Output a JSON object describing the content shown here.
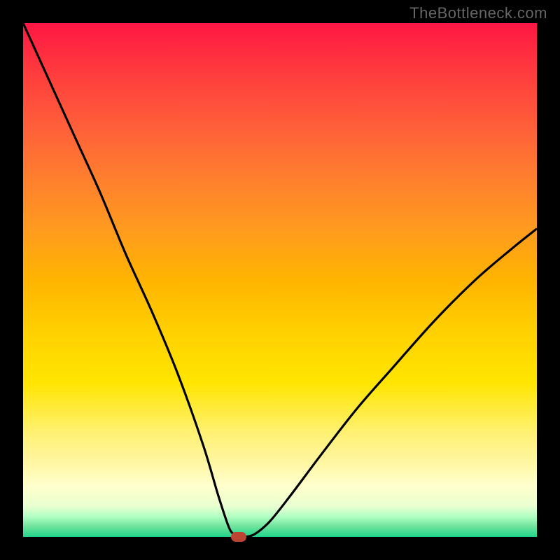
{
  "watermark": "TheBottleneck.com",
  "chart_data": {
    "type": "line",
    "title": "",
    "xlabel": "",
    "ylabel": "",
    "x_range": [
      0,
      100
    ],
    "y_range": [
      0,
      100
    ],
    "series": [
      {
        "name": "bottleneck-curve",
        "x": [
          0,
          5,
          10,
          15,
          20,
          25,
          30,
          35,
          38,
          40,
          41,
          42,
          43,
          45,
          48,
          52,
          58,
          65,
          72,
          80,
          88,
          95,
          100
        ],
        "y": [
          100,
          89,
          78,
          67,
          55,
          44,
          32,
          18,
          8,
          2,
          0.5,
          0,
          0,
          0.5,
          3,
          8,
          16,
          25,
          33,
          42,
          50,
          56,
          60
        ]
      }
    ],
    "marker": {
      "x": 42,
      "y": 0,
      "color": "#bb4433"
    },
    "gradient_stops": [
      {
        "pct": 0,
        "color": "#ff1744"
      },
      {
        "pct": 50,
        "color": "#ffb400"
      },
      {
        "pct": 90,
        "color": "#ffffcc"
      },
      {
        "pct": 100,
        "color": "#1fd58a"
      }
    ]
  }
}
